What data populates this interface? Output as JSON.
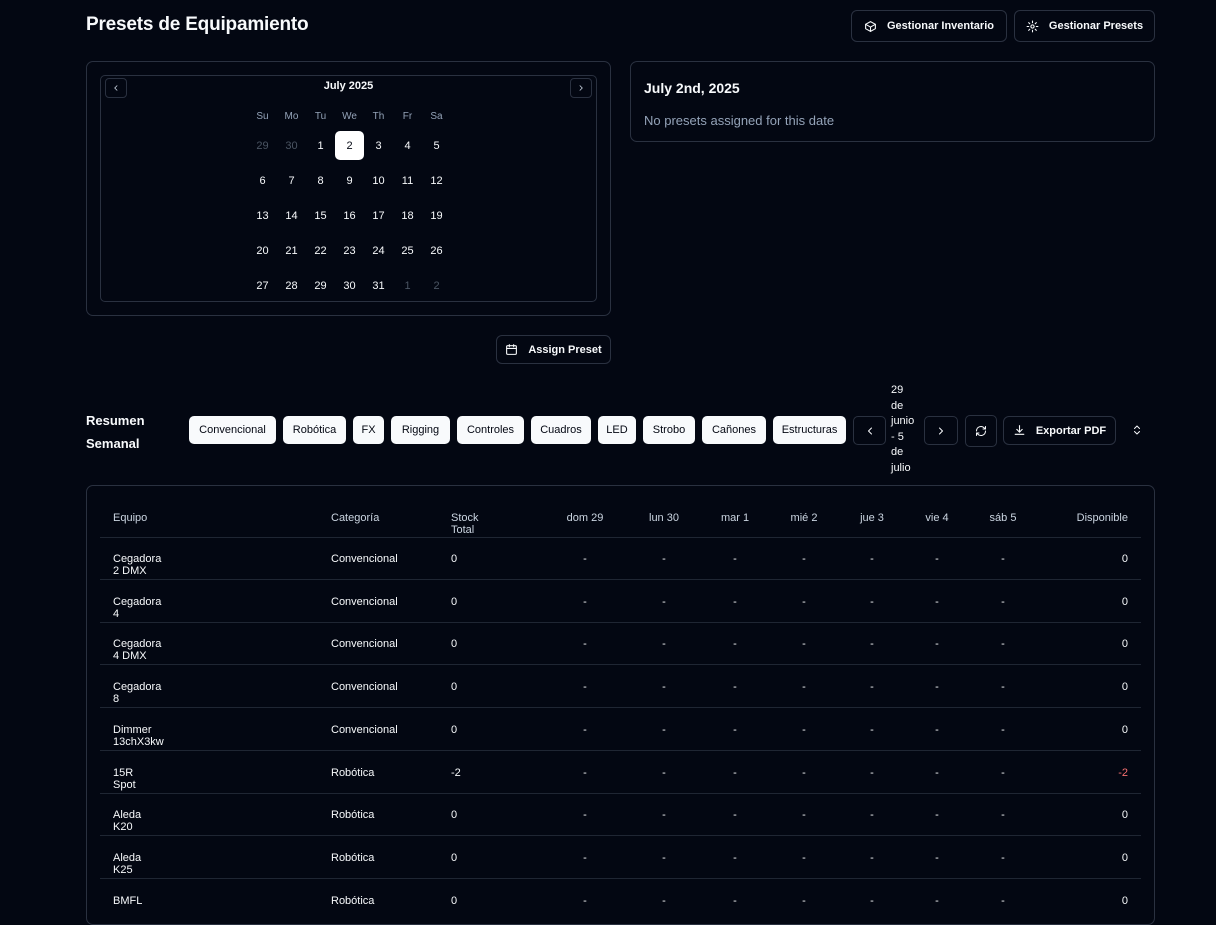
{
  "header": {
    "title": "Presets de Equipamiento",
    "inventory_btn": "Gestionar Inventario",
    "presets_btn": "Gestionar Presets"
  },
  "calendar": {
    "month_label": "July 2025",
    "weekdays": [
      "Su",
      "Mo",
      "Tu",
      "We",
      "Th",
      "Fr",
      "Sa"
    ],
    "weeks": [
      [
        "29",
        "30",
        "1",
        "2",
        "3",
        "4",
        "5"
      ],
      [
        "6",
        "7",
        "8",
        "9",
        "10",
        "11",
        "12"
      ],
      [
        "13",
        "14",
        "15",
        "16",
        "17",
        "18",
        "19"
      ],
      [
        "20",
        "21",
        "22",
        "23",
        "24",
        "25",
        "26"
      ],
      [
        "27",
        "28",
        "29",
        "30",
        "31",
        "1",
        "2"
      ]
    ],
    "selected_day": "2"
  },
  "selected_date": {
    "title": "July 2nd, 2025",
    "message": "No presets assigned for this date"
  },
  "assign_btn": "Assign Preset",
  "weekly": {
    "title_line1": "Resumen",
    "title_line2": "Semanal",
    "filters": [
      "Convencional",
      "Robótica",
      "FX",
      "Rigging",
      "Controles",
      "Cuadros",
      "LED",
      "Strobo",
      "Cañones",
      "Estructuras"
    ],
    "range_lines": [
      "29",
      "de",
      "junio",
      "- 5",
      "de",
      "julio"
    ],
    "export_btn": "Exportar PDF"
  },
  "table": {
    "headers": [
      "Equipo",
      "Categoría",
      "Stock Total",
      "dom 29",
      "lun 30",
      "mar 1",
      "mié 2",
      "jue 3",
      "vie 4",
      "sáb 5",
      "Disponible"
    ],
    "rows": [
      [
        "Cegadora 2 DMX",
        "Convencional",
        "0",
        "-",
        "-",
        "-",
        "-",
        "-",
        "-",
        "-",
        "0"
      ],
      [
        "Cegadora 4",
        "Convencional",
        "0",
        "-",
        "-",
        "-",
        "-",
        "-",
        "-",
        "-",
        "0"
      ],
      [
        "Cegadora 4 DMX",
        "Convencional",
        "0",
        "-",
        "-",
        "-",
        "-",
        "-",
        "-",
        "-",
        "0"
      ],
      [
        "Cegadora 8",
        "Convencional",
        "0",
        "-",
        "-",
        "-",
        "-",
        "-",
        "-",
        "-",
        "0"
      ],
      [
        "Dimmer 13chX3kw",
        "Convencional",
        "0",
        "-",
        "-",
        "-",
        "-",
        "-",
        "-",
        "-",
        "0"
      ],
      [
        "15R Spot",
        "Robótica",
        "-2",
        "-",
        "-",
        "-",
        "-",
        "-",
        "-",
        "-",
        "-2"
      ],
      [
        "Aleda K20",
        "Robótica",
        "0",
        "-",
        "-",
        "-",
        "-",
        "-",
        "-",
        "-",
        "0"
      ],
      [
        "Aleda K25",
        "Robótica",
        "0",
        "-",
        "-",
        "-",
        "-",
        "-",
        "-",
        "-",
        "0"
      ],
      [
        "BMFL",
        "Robótica",
        "0",
        "-",
        "-",
        "-",
        "-",
        "-",
        "-",
        "-",
        "0"
      ]
    ]
  }
}
